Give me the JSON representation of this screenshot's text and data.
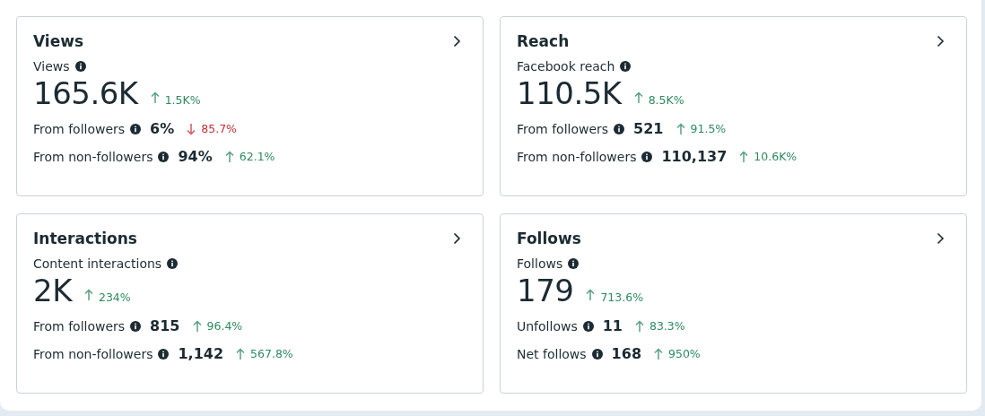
{
  "cards": [
    {
      "title": "Views",
      "metric": {
        "label": "Views",
        "value": "165.6K",
        "change": {
          "kind": "up",
          "text": "1.5K%"
        }
      },
      "rows": [
        {
          "label": "From followers",
          "value": "6%",
          "change": {
            "kind": "down",
            "text": "85.7%"
          }
        },
        {
          "label": "From non-followers",
          "value": "94%",
          "change": {
            "kind": "up",
            "text": "62.1%"
          }
        }
      ]
    },
    {
      "title": "Reach",
      "metric": {
        "label": "Facebook reach",
        "value": "110.5K",
        "change": {
          "kind": "up",
          "text": "8.5K%"
        }
      },
      "rows": [
        {
          "label": "From followers",
          "value": "521",
          "change": {
            "kind": "up",
            "text": "91.5%"
          }
        },
        {
          "label": "From non-followers",
          "value": "110,137",
          "change": {
            "kind": "up",
            "text": "10.6K%"
          }
        }
      ]
    },
    {
      "title": "Interactions",
      "metric": {
        "label": "Content interactions",
        "value": "2K",
        "change": {
          "kind": "up",
          "text": "234%"
        }
      },
      "rows": [
        {
          "label": "From followers",
          "value": "815",
          "change": {
            "kind": "up",
            "text": "96.4%"
          }
        },
        {
          "label": "From non-followers",
          "value": "1,142",
          "change": {
            "kind": "up",
            "text": "567.8%"
          }
        }
      ]
    },
    {
      "title": "Follows",
      "metric": {
        "label": "Follows",
        "value": "179",
        "change": {
          "kind": "up",
          "text": "713.6%"
        }
      },
      "rows": [
        {
          "label": "Unfollows",
          "value": "11",
          "change": {
            "kind": "up",
            "text": "83.3%"
          }
        },
        {
          "label": "Net follows",
          "value": "168",
          "change": {
            "kind": "up",
            "text": "950%"
          }
        }
      ]
    }
  ]
}
